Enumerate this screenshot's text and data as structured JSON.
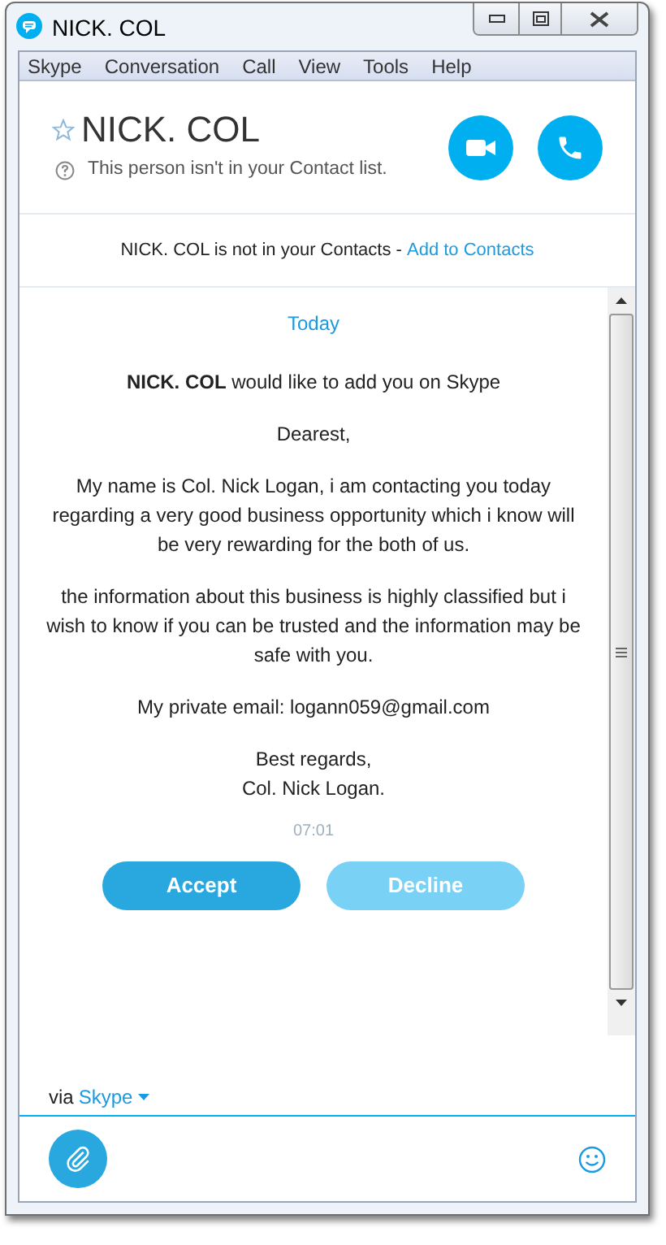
{
  "window": {
    "title": "NICK. COL"
  },
  "menu": [
    "Skype",
    "Conversation",
    "Call",
    "View",
    "Tools",
    "Help"
  ],
  "header": {
    "name": "NICK. COL",
    "favorite": false,
    "status": "This person isn't in your Contact list."
  },
  "notice": {
    "text": "NICK. COL is not in your Contacts - ",
    "link": "Add to Contacts"
  },
  "chat": {
    "date": "Today",
    "request": "**NICK. COL** would like to add you on Skype",
    "paragraphs": [
      "Dearest,",
      "My name is Col. Nick Logan,  i am contacting you today regarding a very good business opportunity which i know will be very rewarding for the both of us.",
      "the information about this business is highly classified but i wish to know if you can be trusted and the information may be safe with you.",
      "My private email: logann059@gmail.com",
      "Best regards,\nCol. Nick Logan."
    ],
    "time": "07:01",
    "buttons": [
      {
        "label": "Accept",
        "kind": "primary"
      },
      {
        "label": "Decline",
        "kind": "secondary"
      }
    ]
  },
  "via": {
    "label": "via",
    "service": "Skype"
  }
}
